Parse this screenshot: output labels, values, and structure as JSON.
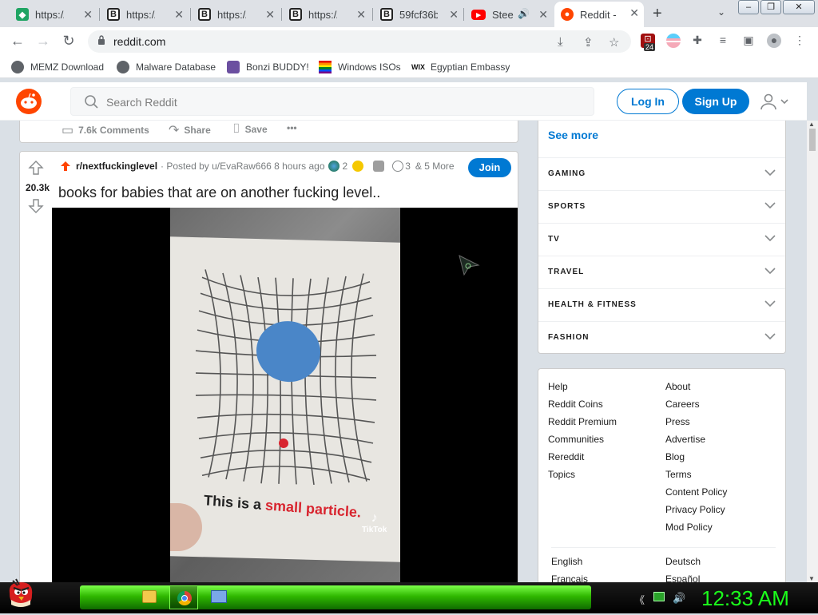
{
  "browser": {
    "tabs": [
      {
        "label": "https://i.",
        "active": false
      },
      {
        "label": "https://tb",
        "active": false
      },
      {
        "label": "https://tb",
        "active": false
      },
      {
        "label": "https://tb",
        "active": false
      },
      {
        "label": "59fcf36b",
        "active": false
      },
      {
        "label": "Stee",
        "active": false
      },
      {
        "label": "Reddit -",
        "active": true
      }
    ],
    "address": "reddit.com",
    "extension_badge": "24",
    "bookmarks": [
      "MEMZ Download",
      "Malware Database",
      "Bonzi BUDDY!",
      "Windows ISOs",
      "Egyptian Embassy"
    ]
  },
  "reddit": {
    "search_placeholder": "Search Reddit",
    "login_label": "Log In",
    "signup_label": "Sign Up",
    "prev_post_actions": {
      "comments": "7.6k Comments",
      "share": "Share",
      "save": "Save",
      "more": "•••"
    },
    "post": {
      "votes": "20.3k",
      "subreddit": "r/nextfuckinglevel",
      "posted_by": "· Posted by u/EvaRaw666 8 hours ago",
      "award_count_1": "2",
      "award_count_2": "3",
      "more_awards": "& 5 More",
      "join_label": "Join",
      "title": "books for babies that are on another fucking level..",
      "media_caption_black": "This is a ",
      "media_caption_red": "small particle.",
      "tiktok_label": "TikTok"
    },
    "sidebar": {
      "see_more": "See more",
      "topics": [
        "GAMING",
        "SPORTS",
        "TV",
        "TRAVEL",
        "HEALTH & FITNESS",
        "FASHION"
      ],
      "links_left": [
        "Help",
        "Reddit Coins",
        "Reddit Premium",
        "Communities",
        "Rereddit",
        "Topics"
      ],
      "links_right": [
        "About",
        "Careers",
        "Press",
        "Advertise",
        "Blog",
        "Terms",
        "Content Policy",
        "Privacy Policy",
        "Mod Policy"
      ],
      "languages_left": [
        "English",
        "Français"
      ],
      "languages_right": [
        "Deutsch",
        "Español"
      ]
    }
  },
  "taskbar": {
    "clock": "12:33 AM"
  },
  "colors": {
    "reddit_blue": "#0079d3",
    "reddit_orange": "#ff4500",
    "clock_green": "#1bff1b"
  }
}
